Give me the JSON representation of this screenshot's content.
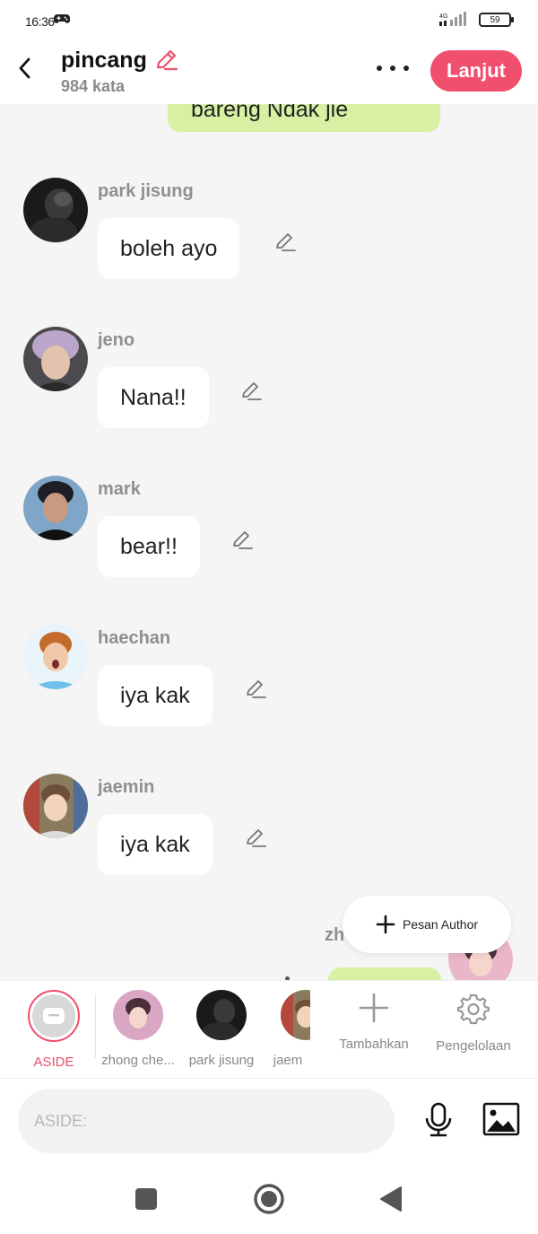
{
  "status_bar": {
    "time": "16:36",
    "network": "4G",
    "battery": "59"
  },
  "header": {
    "title": "pincang",
    "word_count": "984 kata",
    "next_label": "Lanjut"
  },
  "chat": {
    "top_bubble_text": "bareng Ndak jie",
    "messages": [
      {
        "name": "park jisung",
        "text": "boleh ayo"
      },
      {
        "name": "jeno",
        "text": "Nana!!"
      },
      {
        "name": "mark",
        "text": "bear!!"
      },
      {
        "name": "haechan",
        "text": "iya kak"
      },
      {
        "name": "jaemin",
        "text": "iya kak"
      }
    ],
    "partial_name": "zh",
    "author_button": "Pesan Author"
  },
  "characters": [
    {
      "label": "ASIDE"
    },
    {
      "label": "zhong che..."
    },
    {
      "label": "park jisung"
    },
    {
      "label": "jaem"
    }
  ],
  "tools": {
    "add_label": "Tambahkan",
    "manage_label": "Pengelolaan"
  },
  "input": {
    "placeholder": "ASIDE:"
  },
  "colors": {
    "accent": "#f0506e",
    "bubble_green": "#d7f0a4",
    "background": "#f5f5f5"
  }
}
